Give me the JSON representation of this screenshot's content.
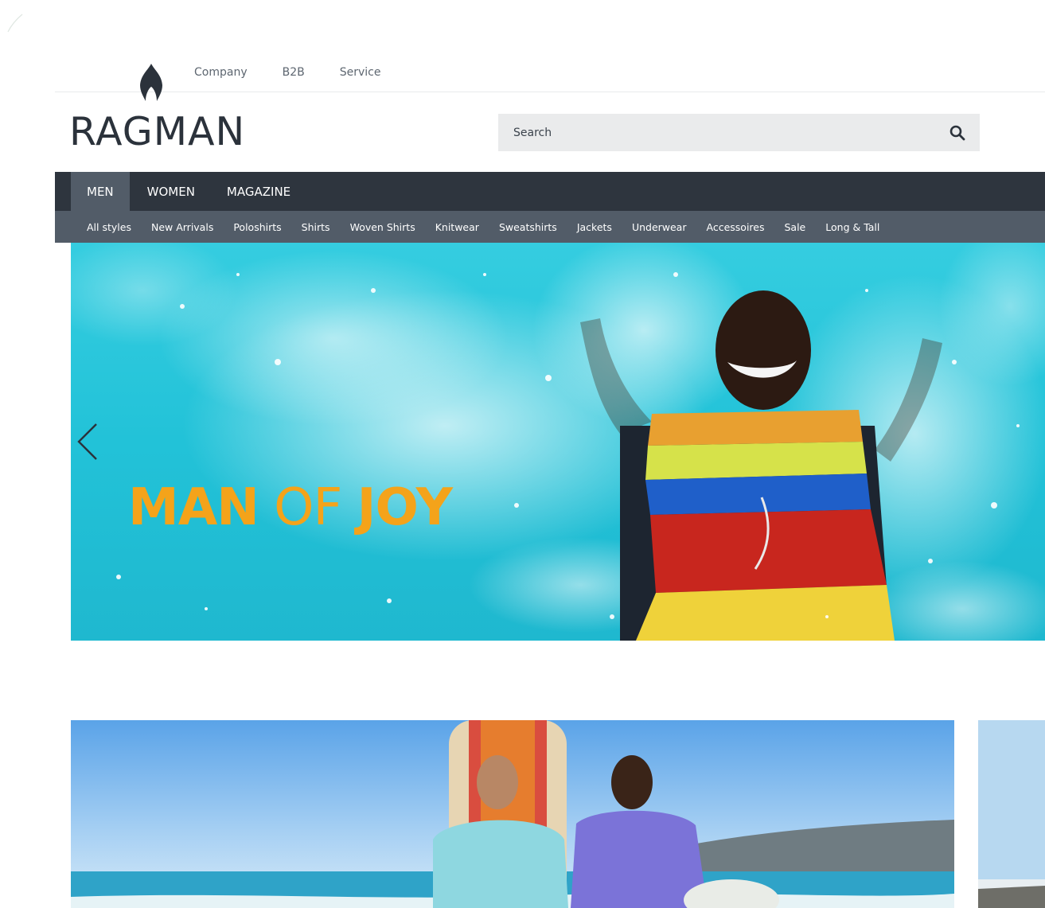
{
  "top_links": [
    "Company",
    "B2B",
    "Service"
  ],
  "logo": {
    "text": "RAGMAN"
  },
  "search": {
    "placeholder": "Search"
  },
  "main_nav": [
    {
      "label": "MEN",
      "active": true
    },
    {
      "label": "WOMEN",
      "active": false
    },
    {
      "label": "MAGAZINE",
      "active": false
    }
  ],
  "sub_nav": [
    "All styles",
    "New Arrivals",
    "Poloshirts",
    "Shirts",
    "Woven Shirts",
    "Knitwear",
    "Sweatshirts",
    "Jackets",
    "Underwear",
    "Accessoires",
    "Sale",
    "Long & Tall"
  ],
  "hero": {
    "headline_1": "MAN",
    "headline_2": "OF",
    "headline_3": "JOY",
    "headline_color": "#f4a31a"
  },
  "colors": {
    "nav_dark": "#2e353e",
    "nav_mid": "#525c68",
    "water": "#2ec9dc",
    "search_bg": "#eaebec"
  },
  "icons": {
    "logo": "flame-icon",
    "search": "magnifier-icon",
    "prev": "chevron-left-icon"
  }
}
